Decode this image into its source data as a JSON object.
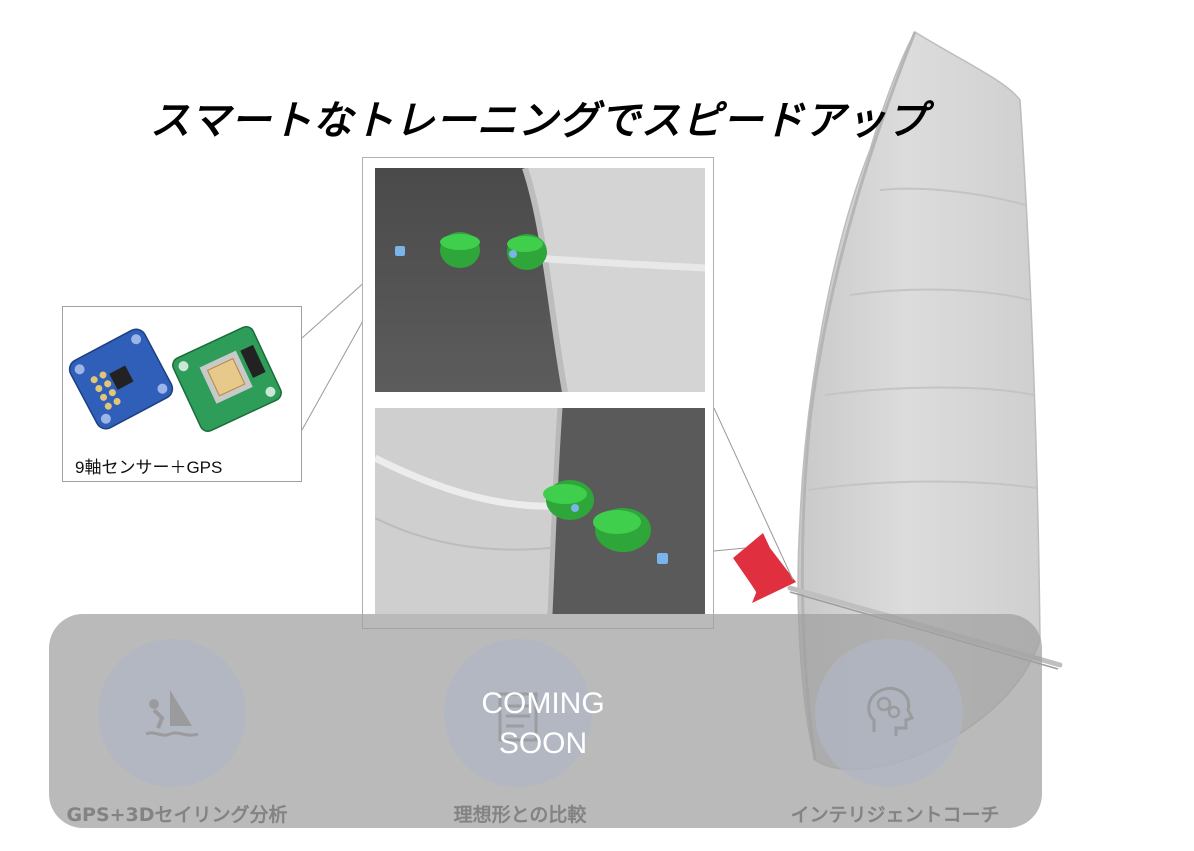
{
  "title": "スマートなトレーニングでスピードアップ",
  "sensor": {
    "label": "9軸センサー＋GPS"
  },
  "overlay": {
    "coming_soon_line1": "COMING",
    "coming_soon_line2": "SOON"
  },
  "features": [
    {
      "label": "GPS+3Dセイリング分析",
      "icon": "windsurfer-icon"
    },
    {
      "label": "理想形との比較",
      "icon": "document-icon"
    },
    {
      "label": "インテリジェントコーチ",
      "icon": "brain-gear-icon"
    }
  ],
  "colors": {
    "sensor_blue": "#2f5fb8",
    "gps_green": "#2e9d5a",
    "mount_green": "#2bb13c",
    "arrow_red": "#e03040",
    "sail_gray": "#d8d8d8"
  }
}
